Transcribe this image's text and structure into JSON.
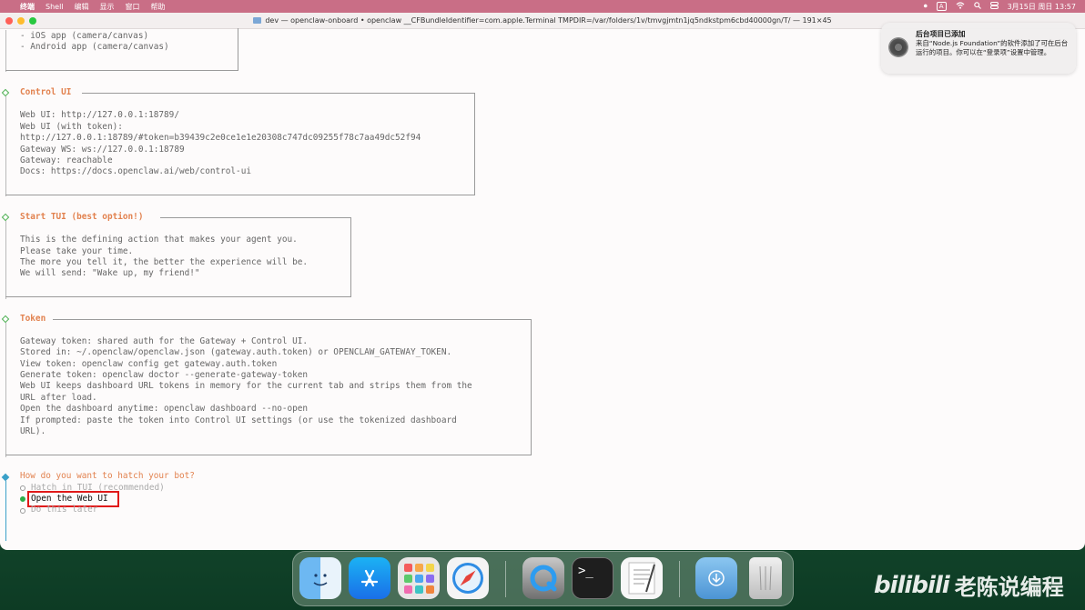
{
  "menubar": {
    "app": "终端",
    "items": [
      "Shell",
      "编辑",
      "显示",
      "窗口",
      "帮助"
    ],
    "input_indicator": "A",
    "datetime": "3月15日 周日 13:57"
  },
  "window": {
    "title": "dev — openclaw-onboard • openclaw __CFBundleIdentifier=com.apple.Terminal TMPDIR=/var/folders/1v/tmvgjmtn1jq5ndkstpm6cbd40000gn/T/ — 191×45"
  },
  "terminal": {
    "top_lines": [
      "- iOS app (camera/canvas)",
      "- Android app (camera/canvas)"
    ],
    "control_ui": {
      "heading": "Control UI",
      "lines": [
        "Web UI: http://127.0.0.1:18789/",
        "Web UI (with token):",
        "http://127.0.0.1:18789/#token=b39439c2e0ce1e1e20308c747dc09255f78c7aa49dc52f94",
        "Gateway WS: ws://127.0.0.1:18789",
        "Gateway: reachable",
        "Docs: https://docs.openclaw.ai/web/control-ui"
      ]
    },
    "start_tui": {
      "heading": "Start TUI (best option!)",
      "lines": [
        "This is the defining action that makes your agent you.",
        "Please take your time.",
        "The more you tell it, the better the experience will be.",
        "We will send: \"Wake up, my friend!\""
      ]
    },
    "token": {
      "heading": "Token",
      "lines": [
        "Gateway token: shared auth for the Gateway + Control UI.",
        "Stored in: ~/.openclaw/openclaw.json (gateway.auth.token) or OPENCLAW_GATEWAY_TOKEN.",
        "View token: openclaw config get gateway.auth.token",
        "Generate token: openclaw doctor --generate-gateway-token",
        "Web UI keeps dashboard URL tokens in memory for the current tab and strips them from the",
        "URL after load.",
        "Open the dashboard anytime: openclaw dashboard --no-open",
        "If prompted: paste the token into Control UI settings (or use the tokenized dashboard",
        "URL)."
      ]
    },
    "prompt": {
      "question": "How do you want to hatch your bot?",
      "options": [
        "Hatch in TUI (recommended)",
        "Open the Web UI",
        "Do this later"
      ],
      "selected_index": 1
    }
  },
  "notification": {
    "title": "后台项目已添加",
    "body": "来自“Node.js Foundation”的软件添加了可在后台运行的项目。你可以在“登录项”设置中管理。"
  },
  "dock": {
    "apps": [
      "finder-icon",
      "app-store-icon",
      "launchpad-icon",
      "safari-icon",
      "quicktime-icon",
      "terminal-icon",
      "textedit-icon",
      "downloads-folder-icon",
      "trash-icon"
    ],
    "terminal_glyph": ">_"
  },
  "watermark": {
    "logo": "bilibili",
    "text": "老陈说编程"
  },
  "colors": {
    "menubar": "#c96e86",
    "heading_orange": "#e2824f",
    "selected_green": "#2eae4a",
    "highlight_red": "#e01818",
    "gutter_blue": "#3ba1c9"
  }
}
